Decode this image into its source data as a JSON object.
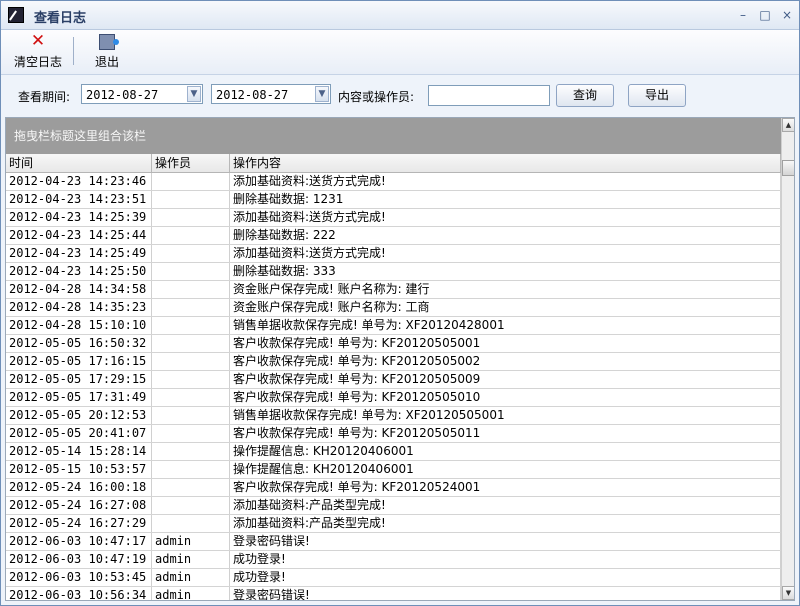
{
  "window": {
    "title": "查看日志",
    "controls": {
      "minimize": "–",
      "maximize": "□",
      "close": "×"
    }
  },
  "toolbar": {
    "clear_label": "清空日志",
    "exit_label": "退出",
    "clear_icon": "✕"
  },
  "filter": {
    "period_label": "查看期间:",
    "start_date": "2012-08-27",
    "end_date": "2012-08-27",
    "content_label": "内容或操作员:",
    "content_value": "",
    "query_label": "查询",
    "export_label": "导出",
    "dropdown_glyph": "▼"
  },
  "grid": {
    "group_hint": "拖曳栏标题这里组合该栏",
    "columns": [
      "时间",
      "操作员",
      "操作内容"
    ],
    "rows": [
      [
        "2012-04-23 14:23:46",
        "",
        "添加基础资料:送货方式完成!"
      ],
      [
        "2012-04-23 14:23:51",
        "",
        "删除基础数据: 1231"
      ],
      [
        "2012-04-23 14:25:39",
        "",
        "添加基础资料:送货方式完成!"
      ],
      [
        "2012-04-23 14:25:44",
        "",
        "删除基础数据: 222"
      ],
      [
        "2012-04-23 14:25:49",
        "",
        "添加基础资料:送货方式完成!"
      ],
      [
        "2012-04-23 14:25:50",
        "",
        "删除基础数据: 333"
      ],
      [
        "2012-04-28 14:34:58",
        "",
        "资金账户保存完成! 账户名称为: 建行"
      ],
      [
        "2012-04-28 14:35:23",
        "",
        "资金账户保存完成! 账户名称为: 工商"
      ],
      [
        "2012-04-28 15:10:10",
        "",
        "销售单据收款保存完成! 单号为: XF20120428001"
      ],
      [
        "2012-05-05 16:50:32",
        "",
        "客户收款保存完成! 单号为: KF20120505001"
      ],
      [
        "2012-05-05 17:16:15",
        "",
        "客户收款保存完成! 单号为: KF20120505002"
      ],
      [
        "2012-05-05 17:29:15",
        "",
        "客户收款保存完成! 单号为: KF20120505009"
      ],
      [
        "2012-05-05 17:31:49",
        "",
        "客户收款保存完成! 单号为: KF20120505010"
      ],
      [
        "2012-05-05 20:12:53",
        "",
        "销售单据收款保存完成! 单号为: XF20120505001"
      ],
      [
        "2012-05-05 20:41:07",
        "",
        "客户收款保存完成! 单号为: KF20120505011"
      ],
      [
        "2012-05-14 15:28:14",
        "",
        "操作提醒信息: KH20120406001"
      ],
      [
        "2012-05-15 10:53:57",
        "",
        "操作提醒信息: KH20120406001"
      ],
      [
        "2012-05-24 16:00:18",
        "",
        "客户收款保存完成! 单号为: KF20120524001"
      ],
      [
        "2012-05-24 16:27:08",
        "",
        "添加基础资料:产品类型完成!"
      ],
      [
        "2012-05-24 16:27:29",
        "",
        "添加基础资料:产品类型完成!"
      ],
      [
        "2012-06-03 10:47:17",
        "admin",
        "登录密码错误!"
      ],
      [
        "2012-06-03 10:47:19",
        "admin",
        "成功登录!"
      ],
      [
        "2012-06-03 10:53:45",
        "admin",
        "成功登录!"
      ],
      [
        "2012-06-03 10:56:34",
        "admin",
        "登录密码错误!"
      ]
    ]
  },
  "scrollbar": {
    "up": "▲",
    "down": "▼"
  }
}
